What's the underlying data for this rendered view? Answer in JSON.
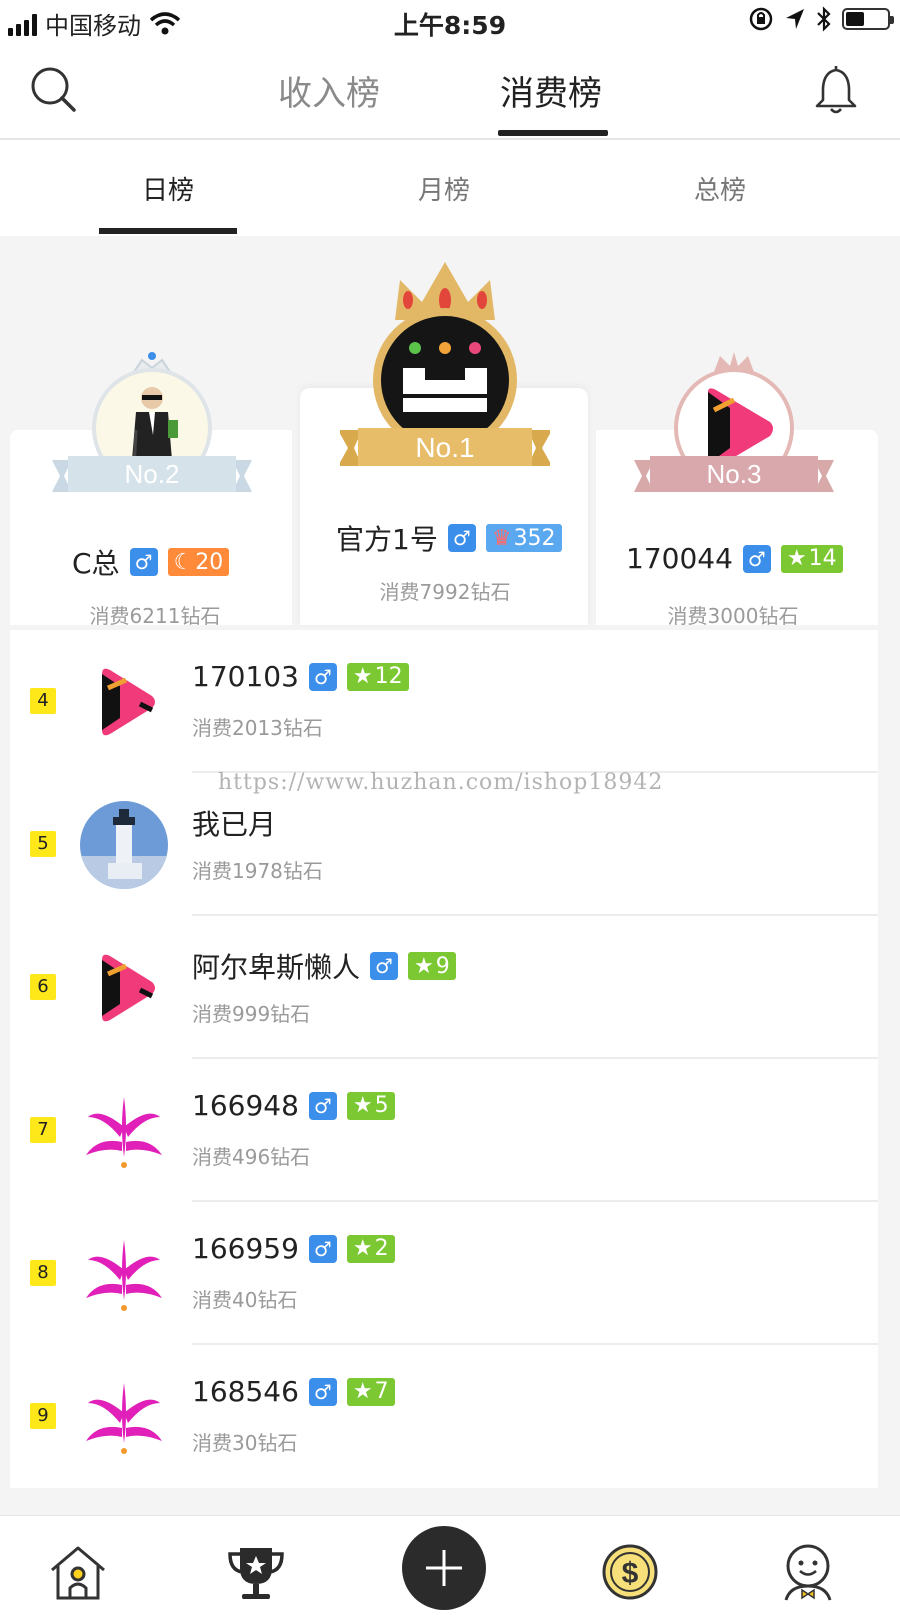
{
  "status": {
    "carrier": "中国移动",
    "time": "上午8:59"
  },
  "top_tabs": [
    {
      "label": "收入榜",
      "active": false
    },
    {
      "label": "消费榜",
      "active": true
    }
  ],
  "sub_tabs": [
    {
      "label": "日榜",
      "active": true
    },
    {
      "label": "月榜",
      "active": false
    },
    {
      "label": "总榜",
      "active": false
    }
  ],
  "podium": {
    "first": {
      "rank_label": "No.1",
      "name": "官方1号",
      "sex": "♂",
      "level": "352",
      "level_icon": "crown-icon",
      "spend": "消费7992钻石"
    },
    "second": {
      "rank_label": "No.2",
      "name": "C总",
      "sex": "♂",
      "level": "20",
      "level_icon": "moon-icon",
      "spend": "消费6211钻石"
    },
    "third": {
      "rank_label": "No.3",
      "name": "170044",
      "sex": "♂",
      "level": "14",
      "level_icon": "star-icon",
      "spend": "消费3000钻石"
    }
  },
  "list": [
    {
      "rank": "4",
      "name": "170103",
      "sex": "♂",
      "level": "12",
      "spend": "消费2013钻石",
      "avatar": "play-logo"
    },
    {
      "rank": "5",
      "name": "我已月",
      "sex": "",
      "level": "",
      "spend": "消费1978钻石",
      "avatar": "lighthouse-photo"
    },
    {
      "rank": "6",
      "name": "阿尔卑斯懒人",
      "sex": "♂",
      "level": "9",
      "spend": "消费999钻石",
      "avatar": "play-logo"
    },
    {
      "rank": "7",
      "name": "166948",
      "sex": "♂",
      "level": "5",
      "spend": "消费496钻石",
      "avatar": "dancer-logo"
    },
    {
      "rank": "8",
      "name": "166959",
      "sex": "♂",
      "level": "2",
      "spend": "消费40钻石",
      "avatar": "dancer-logo"
    },
    {
      "rank": "9",
      "name": "168546",
      "sex": "♂",
      "level": "7",
      "spend": "消费30钻石",
      "avatar": "dancer-logo"
    }
  ],
  "watermark": "https://www.huzhan.com/ishop18942",
  "colors": {
    "sex_badge": "#3b8eea",
    "level_green": "#7cc832",
    "rank_badge": "#ffe81a",
    "gold": "#e3b866"
  }
}
